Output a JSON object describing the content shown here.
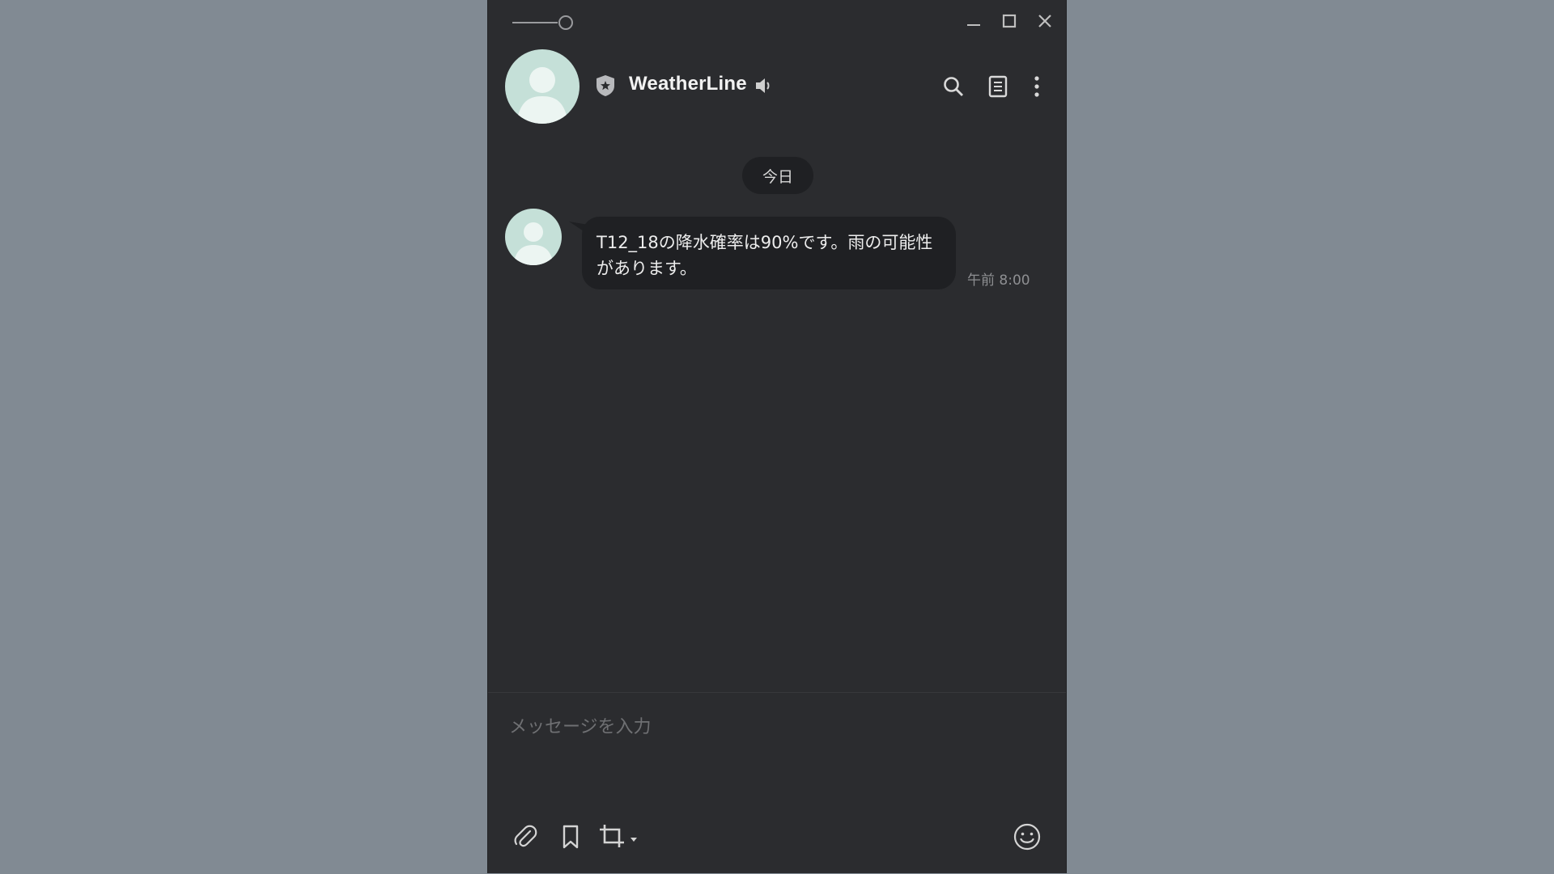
{
  "header": {
    "title": "WeatherLine"
  },
  "messages": {
    "date_label": "今日",
    "items": [
      {
        "text": "T12_18の降水確率は90%です。雨の可能性があります。",
        "time": "午前 8:00"
      }
    ]
  },
  "composer": {
    "placeholder": "メッセージを入力"
  },
  "icons": {
    "opacity": "opacity-slider-icon",
    "minimize": "minimize-icon",
    "maximize": "maximize-icon",
    "close": "close-icon",
    "shield": "official-shield-icon",
    "speaker": "speaker-icon",
    "search": "search-icon",
    "notes": "notes-icon",
    "more": "more-vertical-icon",
    "attach": "paperclip-icon",
    "keep": "bookmark-icon",
    "capture": "crop-icon",
    "emoji": "emoji-icon"
  },
  "colors": {
    "window_bg": "#2b2c2f",
    "bubble_bg": "#1f2023",
    "avatar": "#c5e0d8",
    "desktop": "#818a93"
  }
}
